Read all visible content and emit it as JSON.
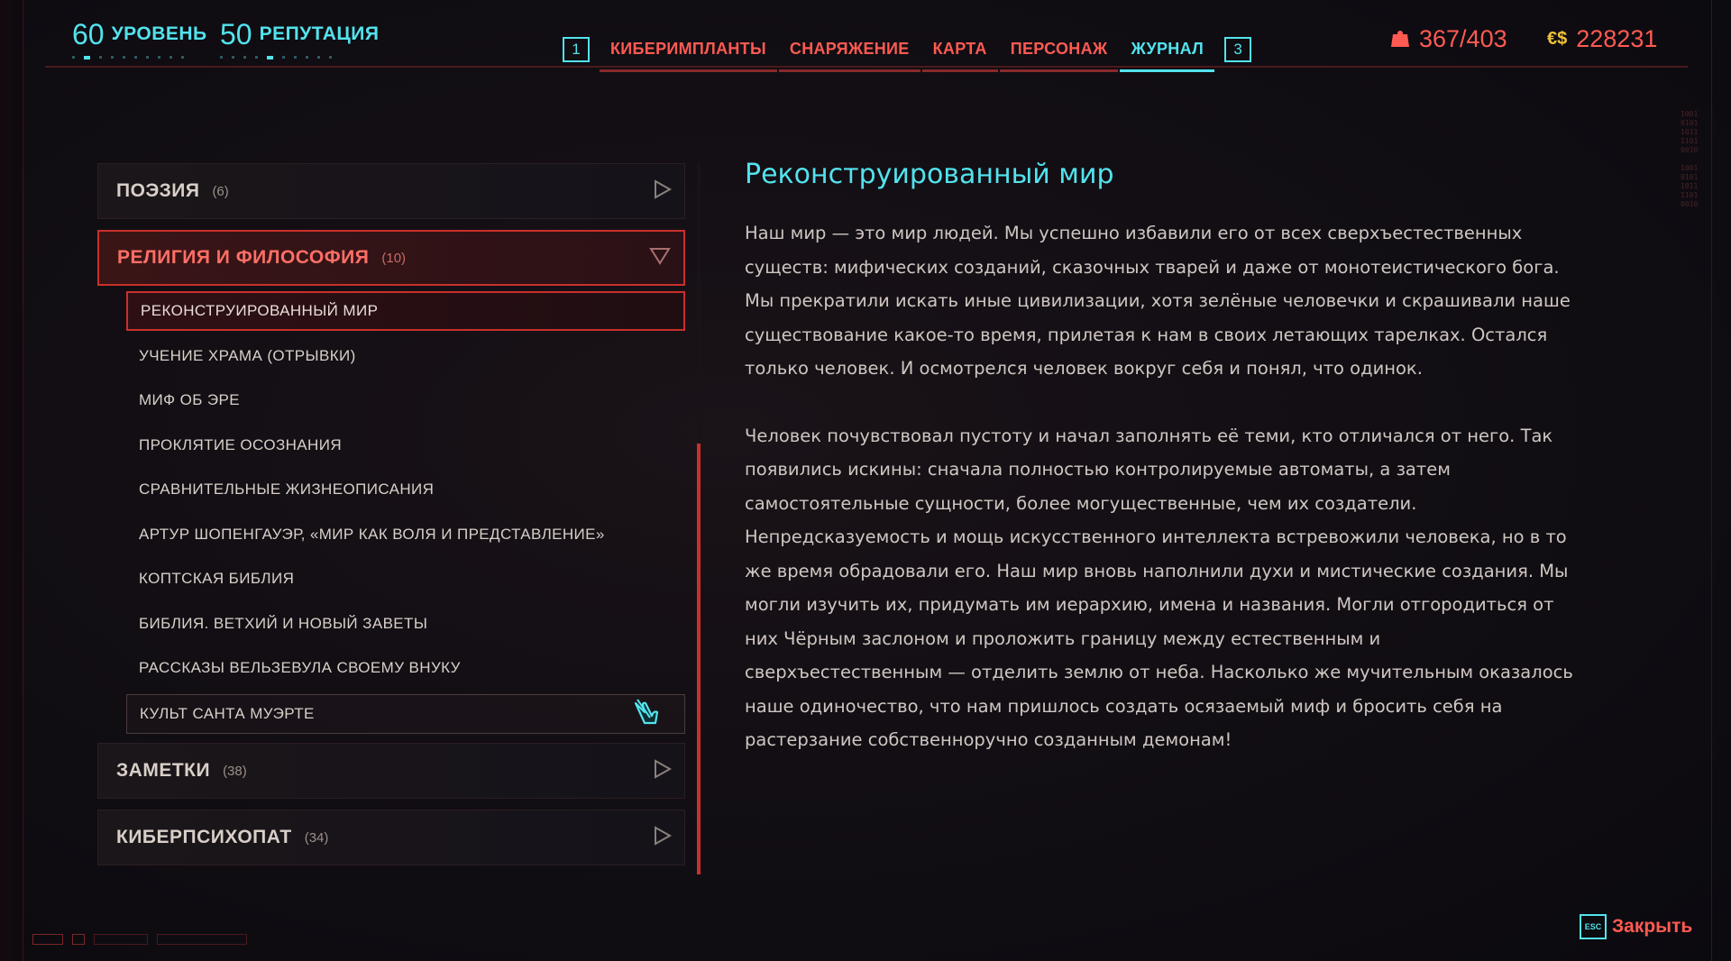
{
  "stats": {
    "level_value": "60",
    "level_label": "УРОВЕНЬ",
    "reputation_value": "50",
    "reputation_label": "РЕПУТАЦИЯ"
  },
  "nav": {
    "left_key": "1",
    "right_key": "3",
    "tabs": [
      {
        "label": "КИБЕРИМПЛАНТЫ",
        "active": false
      },
      {
        "label": "СНАРЯЖЕНИЕ",
        "active": false
      },
      {
        "label": "КАРТА",
        "active": false
      },
      {
        "label": "ПЕРСОНАЖ",
        "active": false
      },
      {
        "label": "ЖУРНАЛ",
        "active": true
      }
    ]
  },
  "status": {
    "carry_weight": "367/403",
    "currency_symbol": "€$",
    "money": "228231"
  },
  "categories": [
    {
      "name": "ПОЭЗИЯ",
      "count": "(6)",
      "open": false
    },
    {
      "name": "РЕЛИГИЯ И ФИЛОСОФИЯ",
      "count": "(10)",
      "open": true
    },
    {
      "name": "ЗАМЕТКИ",
      "count": "(38)",
      "open": false
    },
    {
      "name": "КИБЕРПСИХОПАТ",
      "count": "(34)",
      "open": false
    }
  ],
  "items": [
    "РЕКОНСТРУИРОВАННЫЙ МИР",
    "УЧЕНИЕ ХРАМА (ОТРЫВКИ)",
    "МИФ ОБ ЭРЕ",
    "ПРОКЛЯТИЕ ОСОЗНАНИЯ",
    "СРАВНИТЕЛЬНЫЕ ЖИЗНЕОПИСАНИЯ",
    "АРТУР ШОПЕНГАУЭР, «МИР КАК ВОЛЯ И ПРЕДСТАВЛЕНИЕ»",
    "КОПТСКАЯ БИБЛИЯ",
    "БИБЛИЯ. ВЕТХИЙ И НОВЫЙ ЗАВЕТЫ",
    "РАССКАЗЫ ВЕЛЬЗЕВУЛА СВОЕМУ ВНУКУ",
    "КУЛЬТ САНТА МУЭРТЕ"
  ],
  "entry": {
    "title": "Реконструированный мир",
    "paragraphs": [
      "Наш мир — это мир людей. Мы успешно избавили его от всех сверхъестественных существ: мифических созданий, сказочных тварей и даже от монотеистического бога. Мы прекратили искать иные цивилизации, хотя зелёные человечки и скрашивали наше существование какое-то время, прилетая к нам в своих летающих тарелках. Остался только человек. И осмотрелся человек вокруг себя и понял, что одинок.",
      "Человек почувствовал пустоту и начал заполнять её теми, кто отличался от него. Так появились искины: сначала полностью контролируемые автоматы, а затем самостоятельные сущности, более могущественные, чем их создатели. Непредсказуемость и мощь искусственного интеллекта встревожили человека, но в то же время обрадовали его. Наш мир вновь наполнили духи и мистические создания. Мы могли изучить их, придумать им иерархию, имена и названия. Могли отгородиться от них Чёрным заслоном и проложить границу между естественным и сверхъестественным — отделить землю от неба. Насколько же мучительным оказалось наше одиночество, что нам пришлось создать осязаемый миф и бросить себя на растерзание собственноручно созданным демонам!"
    ]
  },
  "footer": {
    "esc_key": "ESC",
    "close_label": "Закрыть"
  },
  "colors": {
    "cyan": "#52e3ed",
    "red": "#ff5a52",
    "gold": "#f0c23a"
  }
}
